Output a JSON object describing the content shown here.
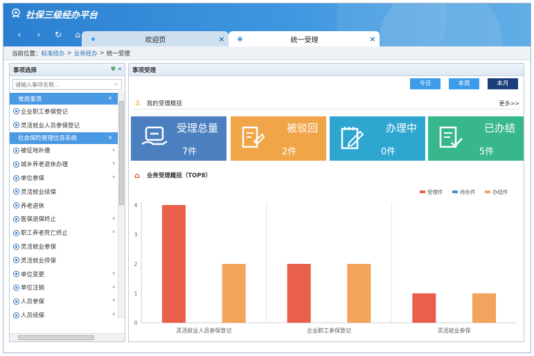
{
  "app": {
    "title": "社保三级经办平台"
  },
  "nav": {
    "back": "‹",
    "forward": "›",
    "refresh": "↻",
    "home": "⌂"
  },
  "tabs": [
    {
      "label": "欢迎页",
      "close": "×"
    },
    {
      "label": "统一受理",
      "close": "×"
    }
  ],
  "breadcrumb": {
    "prefix": "当前位置：",
    "level1": "标准经办",
    "sep1": ">",
    "level2": "业务经办",
    "sep2": ">",
    "current": "统一受理"
  },
  "sidebar": {
    "title": "事项选择",
    "search_placeholder": "请输入事项名称...",
    "group1": "常用事项",
    "group1_items": [
      "企业职工参保登记",
      "灵活就业人员参保登记"
    ],
    "group2": "社会保险管理信息系统",
    "items": [
      {
        "label": "被征地补缴",
        "arrow": true
      },
      {
        "label": "城乡养老退休办理",
        "arrow": true
      },
      {
        "label": "单位参保",
        "arrow": true
      },
      {
        "label": "灵活就业续保",
        "arrow": false
      },
      {
        "label": "养老退休",
        "arrow": false
      },
      {
        "label": "医保退保终止",
        "arrow": true
      },
      {
        "label": "职工养老死亡终止",
        "arrow": true
      },
      {
        "label": "灵活就业参保",
        "arrow": false
      },
      {
        "label": "灵活就业停保",
        "arrow": false
      },
      {
        "label": "单位变更",
        "arrow": true
      },
      {
        "label": "单位注销",
        "arrow": true
      },
      {
        "label": "人员参保",
        "arrow": true
      },
      {
        "label": "人员续保",
        "arrow": true
      }
    ]
  },
  "main": {
    "title": "事项受理",
    "periods": [
      "今日",
      "本周",
      "本月"
    ],
    "active_period": "本月",
    "summary_title": "我的受理概括",
    "more": "更多>>",
    "cards": [
      {
        "label": "受理总量",
        "value": "7件",
        "icon": "wallet-icon",
        "color": "#4b7fc0"
      },
      {
        "label": "被驳回",
        "value": "2件",
        "icon": "rejected-doc-icon",
        "color": "#f0a548"
      },
      {
        "label": "办理中",
        "value": "0件",
        "icon": "edit-doc-icon",
        "color": "#2ea6d0"
      },
      {
        "label": "已办结",
        "value": "5件",
        "icon": "done-doc-icon",
        "color": "#38b78a"
      }
    ],
    "chart_title": "业务受理概括（TOP8）"
  },
  "chart_data": {
    "type": "bar",
    "title": "业务受理概括（TOP8）",
    "categories": [
      "灵活就业人员参保登记",
      "企业职工参保登记",
      "灵活就业参保"
    ],
    "series": [
      {
        "name": "受理件",
        "values": [
          4,
          2,
          1
        ],
        "color": "#e8604a"
      },
      {
        "name": "待办件",
        "values": [
          0,
          0,
          0
        ],
        "color": "#3d8fd6"
      },
      {
        "name": "办结件",
        "values": [
          2,
          2,
          1
        ],
        "color": "#f4a35c"
      }
    ],
    "ylim": [
      0,
      4
    ],
    "yticks": [
      "0",
      "1",
      "2",
      "3",
      "4"
    ],
    "legend_position": "top-right",
    "grid": false
  }
}
